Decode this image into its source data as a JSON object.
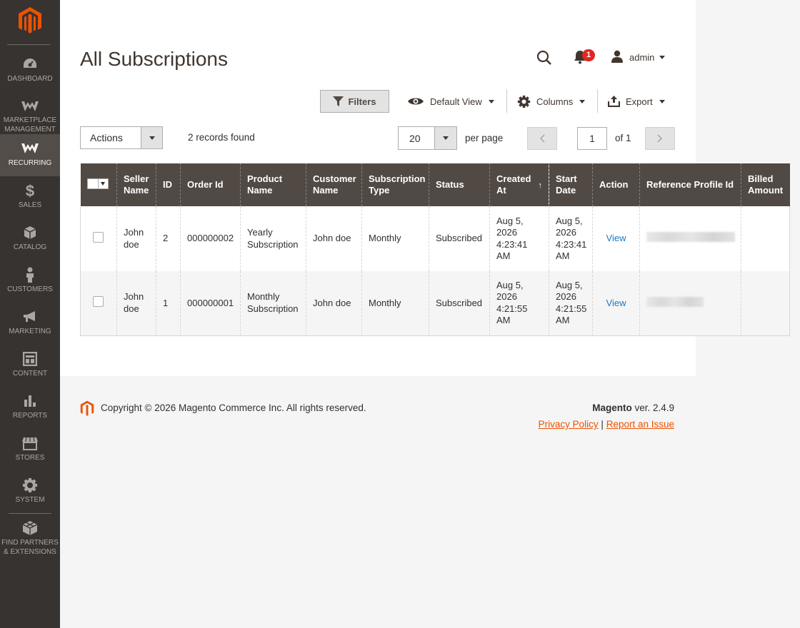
{
  "sidebar": {
    "items": [
      {
        "label": "DASHBOARD",
        "icon": "dashboard-icon"
      },
      {
        "label": "MARKETPLACE MANAGEMENT",
        "icon": "webkul-icon"
      },
      {
        "label": "RECURRING",
        "icon": "webkul-icon",
        "active": true
      },
      {
        "label": "SALES",
        "icon": "dollar-icon"
      },
      {
        "label": "CATALOG",
        "icon": "box-icon"
      },
      {
        "label": "CUSTOMERS",
        "icon": "person-icon"
      },
      {
        "label": "MARKETING",
        "icon": "megaphone-icon"
      },
      {
        "label": "CONTENT",
        "icon": "layout-icon"
      },
      {
        "label": "REPORTS",
        "icon": "bar-chart-icon"
      },
      {
        "label": "STORES",
        "icon": "store-icon"
      },
      {
        "label": "SYSTEM",
        "icon": "gear-icon"
      },
      {
        "label": "FIND PARTNERS & EXTENSIONS",
        "icon": "extensions-icon"
      }
    ]
  },
  "header": {
    "title": "All Subscriptions",
    "notifications_count": "1",
    "user": "admin"
  },
  "toolbar": {
    "filters": "Filters",
    "view": "Default View",
    "columns": "Columns",
    "export": "Export"
  },
  "grid_controls": {
    "actions": "Actions",
    "records": "2 records found",
    "per_page_value": "20",
    "per_page_label": "per page",
    "page": "1",
    "of_pages": "of 1"
  },
  "table": {
    "headers": {
      "seller_name": "Seller Name",
      "id": "ID",
      "order_id": "Order Id",
      "product_name": "Product Name",
      "customer_name": "Customer Name",
      "subscription_type": "Subscription Type",
      "status": "Status",
      "created_at": "Created At",
      "start_date": "Start Date",
      "action": "Action",
      "reference_profile_id": "Reference Profile Id",
      "billed_amount": "Billed Amount"
    },
    "rows": [
      {
        "seller_name": "John doe",
        "id": "2",
        "order_id": "000000002",
        "product_name": "Yearly Subscription",
        "customer_name": "John doe",
        "subscription_type": "Monthly",
        "status": "Subscribed",
        "created_at": "Aug 5, 2026 4:23:41 AM",
        "start_date": "Aug 5, 2026 4:23:41 AM",
        "action": "View",
        "billed_amount": ""
      },
      {
        "seller_name": "John doe",
        "id": "1",
        "order_id": "000000001",
        "product_name": "Monthly Subscription",
        "customer_name": "John doe",
        "subscription_type": "Monthly",
        "status": "Subscribed",
        "created_at": "Aug 5, 2026 4:21:55 AM",
        "start_date": "Aug 5, 2026 4:21:55 AM",
        "action": "View",
        "billed_amount": ""
      }
    ]
  },
  "footer": {
    "copyright": "Copyright © 2026 Magento Commerce Inc. All rights reserved.",
    "brand": "Magento",
    "version": " ver. 2.4.9",
    "privacy": "Privacy Policy",
    "separator": " | ",
    "report": "Report an Issue"
  },
  "colors": {
    "sidebar_bg": "#373330",
    "accent": "#eb5202",
    "table_header_bg": "#514943",
    "link": "#1979c3"
  }
}
